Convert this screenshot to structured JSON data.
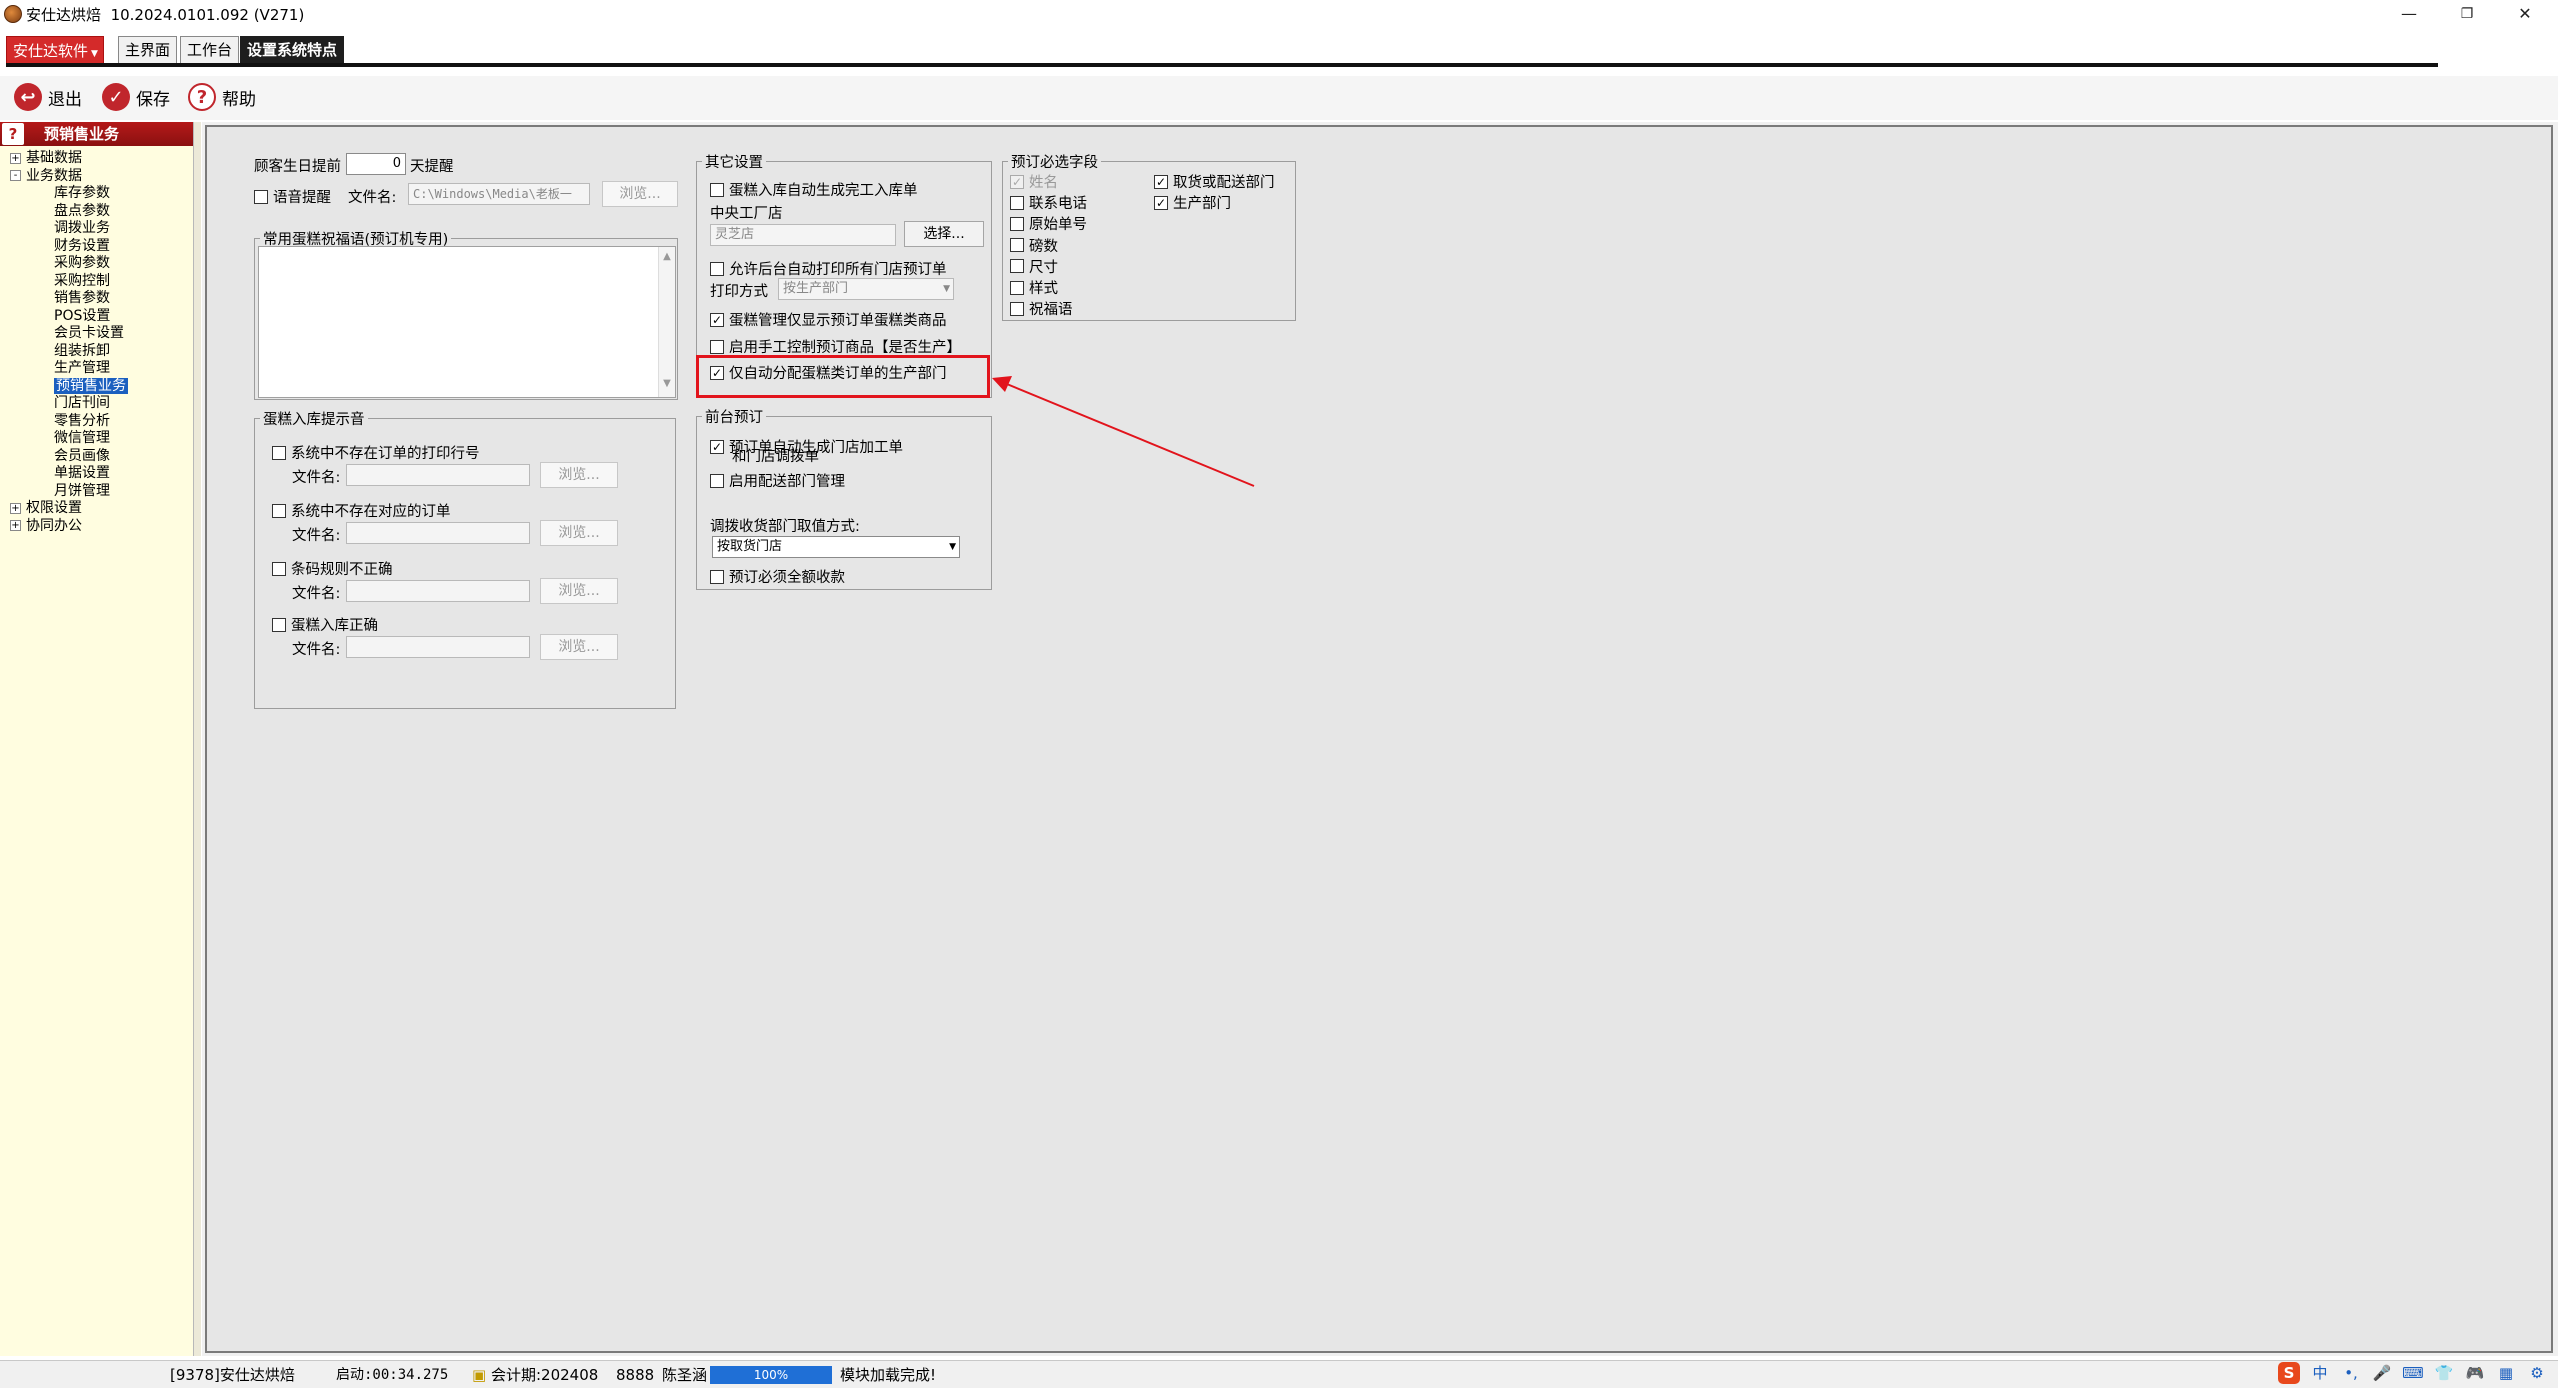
{
  "window": {
    "app_name": "安仕达烘焙",
    "version": "10.2024.0101.092 (V271)",
    "minimize": "—",
    "restore": "❐",
    "close": "✕"
  },
  "tabs": {
    "brand": "安仕达软件",
    "items": [
      "主界面",
      "工作台",
      "设置系统特点"
    ]
  },
  "toolbar": {
    "exit": "退出",
    "save": "保存",
    "help": "帮助"
  },
  "sidebar": {
    "header": "预销售业务",
    "tree": [
      {
        "label": "基础数据",
        "level": 0,
        "expander": "+"
      },
      {
        "label": "业务数据",
        "level": 0,
        "expander": "-"
      },
      {
        "label": "库存参数",
        "level": 1
      },
      {
        "label": "盘点参数",
        "level": 1
      },
      {
        "label": "调拨业务",
        "level": 1
      },
      {
        "label": "财务设置",
        "level": 1
      },
      {
        "label": "采购参数",
        "level": 1
      },
      {
        "label": "采购控制",
        "level": 1
      },
      {
        "label": "销售参数",
        "level": 1
      },
      {
        "label": "POS设置",
        "level": 1
      },
      {
        "label": "会员卡设置",
        "level": 1
      },
      {
        "label": "组装拆卸",
        "level": 1
      },
      {
        "label": "生产管理",
        "level": 1
      },
      {
        "label": "预销售业务",
        "level": 1,
        "selected": true
      },
      {
        "label": "门店刊间",
        "level": 1
      },
      {
        "label": "零售分析",
        "level": 1
      },
      {
        "label": "微信管理",
        "level": 1
      },
      {
        "label": "会员画像",
        "level": 1
      },
      {
        "label": "单据设置",
        "level": 1
      },
      {
        "label": "月饼管理",
        "level": 1
      },
      {
        "label": "权限设置",
        "level": 0,
        "expander": "+"
      },
      {
        "label": "协同办公",
        "level": 0,
        "expander": "+"
      }
    ]
  },
  "birthday": {
    "prefix": "顾客生日提前",
    "days": "0",
    "suffix": "天提醒",
    "voice_label": "语音提醒",
    "file_label": "文件名:",
    "file_value": "C:\\Windows\\Media\\老板一",
    "browse": "浏览..."
  },
  "greetings": {
    "title": "常用蛋糕祝福语(预订机专用)"
  },
  "cake_sound": {
    "title": "蛋糕入库提示音",
    "items": [
      {
        "label": "系统中不存在订单的打印行号"
      },
      {
        "label": "系统中不存在对应的订单"
      },
      {
        "label": "条码规则不正确"
      },
      {
        "label": "蛋糕入库正确"
      }
    ],
    "file_label": "文件名:",
    "browse": "浏览..."
  },
  "other": {
    "title": "其它设置",
    "auto_inbound": "蛋糕入库自动生成完工入库单",
    "factory_label": "中央工厂店",
    "factory_value": "灵芝店",
    "choose": "选择...",
    "allow_print": "允许后台自动打印所有门店预订单",
    "print_mode_label": "打印方式",
    "print_mode_value": "按生产部门",
    "only_cake": "蛋糕管理仅显示预订单蛋糕类商品",
    "manual_control": "启用手工控制预订商品【是否生产】",
    "auto_assign": "仅自动分配蛋糕类订单的生产部门"
  },
  "front": {
    "title": "前台预订",
    "auto_gen": "预订单自动生成门店加工单",
    "auto_gen_line2": "和门店调拨单",
    "enable_dist": "启用配送部门管理",
    "dept_label": "调拨收货部门取值方式:",
    "dept_value": "按取货门店",
    "full_payment": "预订必须全额收款"
  },
  "required": {
    "title": "预订必选字段",
    "left": [
      {
        "label": "姓名",
        "checked": true,
        "disabled": true
      },
      {
        "label": "联系电话",
        "checked": false
      },
      {
        "label": "原始单号",
        "checked": false
      },
      {
        "label": "磅数",
        "checked": false
      },
      {
        "label": "尺寸",
        "checked": false
      },
      {
        "label": "样式",
        "checked": false
      },
      {
        "label": "祝福语",
        "checked": false
      }
    ],
    "right": [
      {
        "label": "取货或配送部门",
        "checked": true
      },
      {
        "label": "生产部门",
        "checked": true
      }
    ]
  },
  "status": {
    "user": "[9378]安仕达烘焙",
    "startup": "启动:00:34.275",
    "period": "会计期:202408",
    "code": "8888",
    "operator": "陈圣涵",
    "progress": "100%",
    "message": "模块加载完成!"
  },
  "tray": [
    "S",
    "中",
    "•,",
    "🎤",
    "⌨",
    "👕",
    "🎮",
    "▦",
    "⚙"
  ],
  "colors": {
    "brand_red": "#d42a2a",
    "highlight": "#e2141c",
    "selection": "#1b5fbf",
    "sidebar_bg": "#fffde0"
  }
}
